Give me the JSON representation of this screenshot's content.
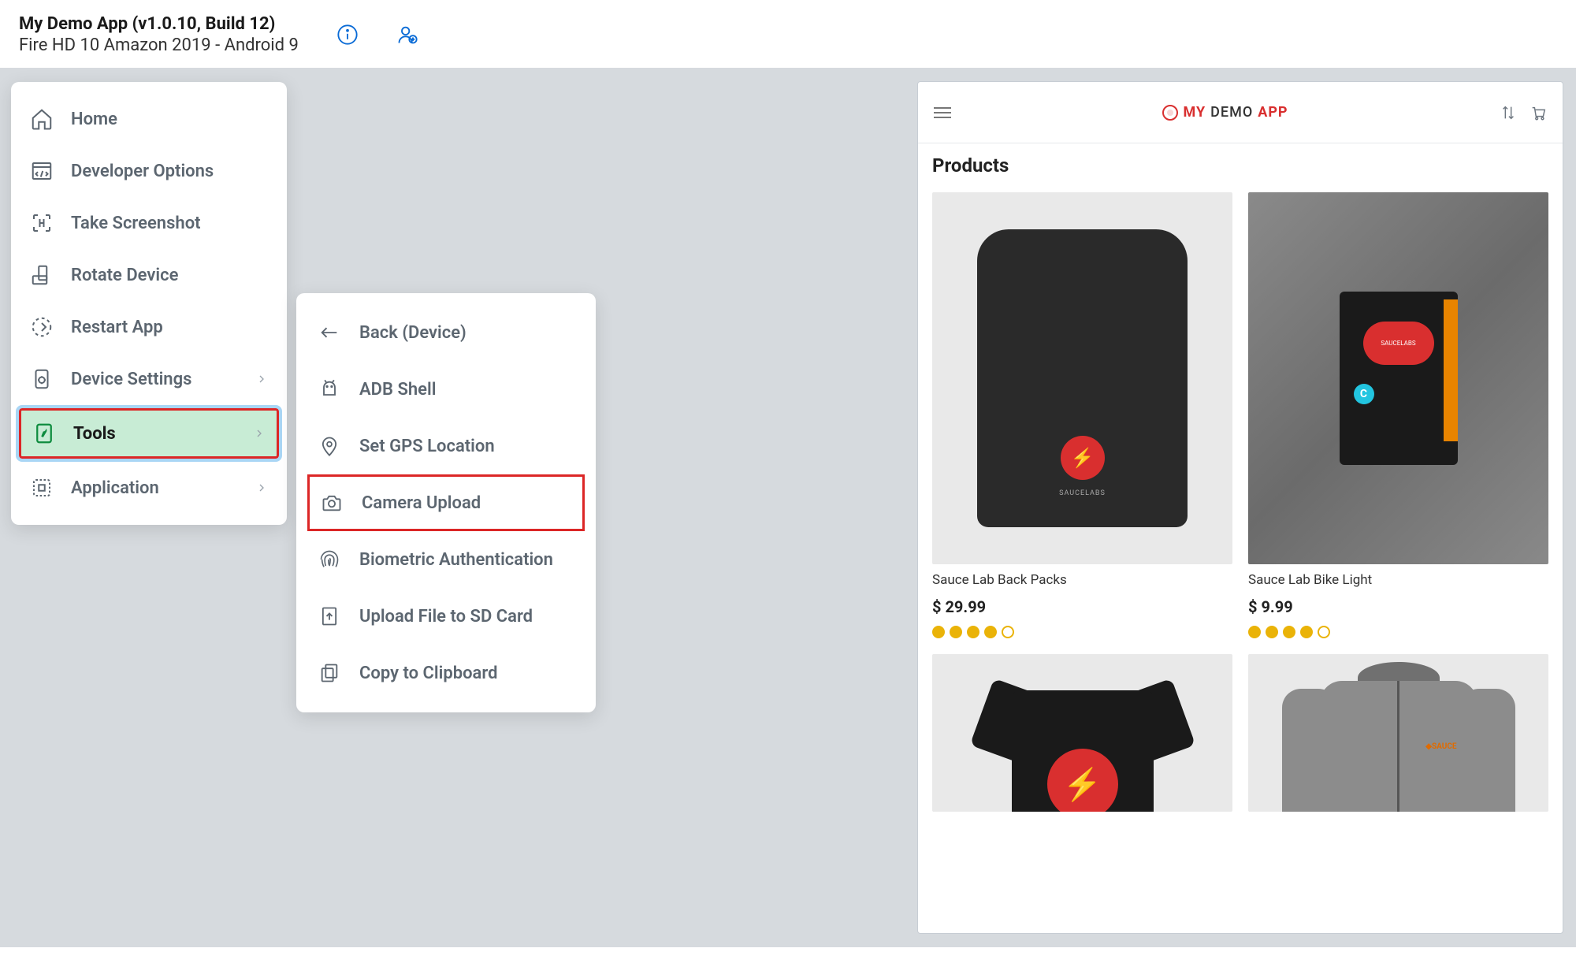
{
  "header": {
    "title": "My Demo App (v1.0.10, Build 12)",
    "subtitle": "Fire HD 10 Amazon 2019 - Android 9"
  },
  "mainMenu": [
    {
      "label": "Home",
      "icon": "home",
      "hasChevron": false,
      "selected": false
    },
    {
      "label": "Developer Options",
      "icon": "dev-options",
      "hasChevron": false,
      "selected": false
    },
    {
      "label": "Take Screenshot",
      "icon": "screenshot",
      "hasChevron": false,
      "selected": false
    },
    {
      "label": "Rotate Device",
      "icon": "rotate",
      "hasChevron": false,
      "selected": false
    },
    {
      "label": "Restart App",
      "icon": "restart",
      "hasChevron": false,
      "selected": false
    },
    {
      "label": "Device Settings",
      "icon": "settings",
      "hasChevron": true,
      "selected": false
    },
    {
      "label": "Tools",
      "icon": "tools",
      "hasChevron": true,
      "selected": true
    },
    {
      "label": "Application",
      "icon": "application",
      "hasChevron": true,
      "selected": false
    }
  ],
  "subMenu": [
    {
      "label": "Back (Device)",
      "icon": "back",
      "highlighted": false
    },
    {
      "label": "ADB Shell",
      "icon": "adb",
      "highlighted": false
    },
    {
      "label": "Set GPS Location",
      "icon": "gps",
      "highlighted": false
    },
    {
      "label": "Camera Upload",
      "icon": "camera",
      "highlighted": true
    },
    {
      "label": "Biometric Authentication",
      "icon": "fingerprint",
      "highlighted": false
    },
    {
      "label": "Upload File to SD Card",
      "icon": "upload",
      "highlighted": false
    },
    {
      "label": "Copy to Clipboard",
      "icon": "clipboard",
      "highlighted": false
    }
  ],
  "device": {
    "brandPrefix": "MY",
    "brandBold": "DEMO",
    "brandSuffix": "APP",
    "productsTitle": "Products",
    "products": [
      {
        "name": "Sauce Lab Back Packs",
        "price": "$ 29.99",
        "rating": 4
      },
      {
        "name": "Sauce Lab Bike Light",
        "price": "$ 9.99",
        "rating": 4
      }
    ]
  }
}
